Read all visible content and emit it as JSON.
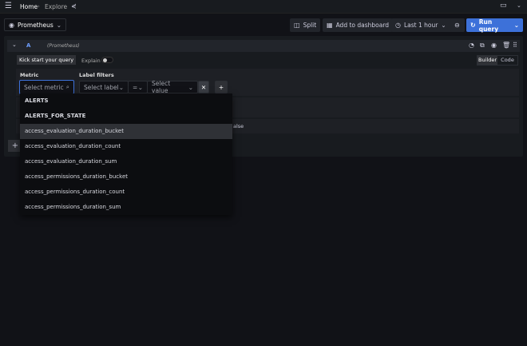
{
  "topbar": {
    "breadcrumb": [
      "Home",
      "Explore"
    ]
  },
  "toolbar": {
    "datasource": "Prometheus",
    "split": "Split",
    "add_to_dashboard": "Add to dashboard",
    "time_range": "Last 1 hour",
    "run_query": "Run query"
  },
  "query": {
    "ref": "A",
    "datasource": "(Prometheus)",
    "kickstart": "Kick start your query",
    "explain": "Explain",
    "explain_on": false,
    "mode_builder": "Builder",
    "mode_code": "Code",
    "active_mode": "Builder",
    "metric_label": "Metric",
    "metric_placeholder": "Select metric",
    "label_filters": "Label filters",
    "label_placeholder": "Select label",
    "operator": "=",
    "value_placeholder": "Select value",
    "partial_text": "alse"
  },
  "dropdown": {
    "options": [
      "ALERTS",
      "ALERTS_FOR_STATE",
      "access_evaluation_duration_bucket",
      "access_evaluation_duration_count",
      "access_evaluation_duration_sum",
      "access_permissions_duration_bucket",
      "access_permissions_duration_count",
      "access_permissions_duration_sum"
    ],
    "highlighted": "access_evaluation_duration_bucket"
  },
  "colors": {
    "accent": "#3d71d9",
    "background": "#111217"
  }
}
